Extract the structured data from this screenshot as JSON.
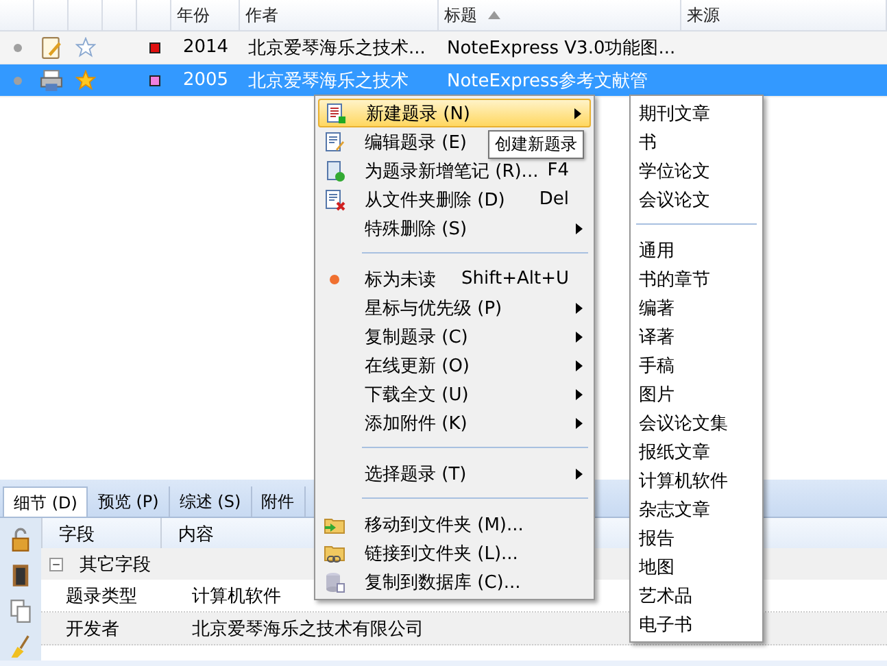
{
  "table": {
    "columns": [
      {},
      {},
      {},
      {},
      {},
      {
        "label": "年份"
      },
      {
        "label": "作者"
      },
      {
        "label": "标题",
        "sorted": true
      },
      {
        "label": "来源"
      }
    ],
    "rows": [
      {
        "selected": false,
        "starred": false,
        "color": "#e01010",
        "year": "2014",
        "author": "北京爱琴海乐之技术...",
        "title": "NoteExpress V3.0功能图..."
      },
      {
        "selected": true,
        "starred": true,
        "color": "#f080e0",
        "year": "2005",
        "author": "北京爱琴海乐之技术",
        "title": "NoteExpress参考文献管"
      }
    ]
  },
  "context_menu": {
    "items": [
      {
        "kind": "item",
        "label": "新建题录 (N)",
        "submenu": true,
        "selected": true
      },
      {
        "kind": "item",
        "label": "编辑题录 (E)",
        "selected": false
      },
      {
        "kind": "item",
        "label": "为题录新增笔记 (R)...",
        "shortcut": "F4",
        "selected": false
      },
      {
        "kind": "item",
        "label": "从文件夹删除 (D)",
        "shortcut": "Del",
        "selected": false
      },
      {
        "kind": "item",
        "label": "特殊删除 (S)",
        "submenu": true,
        "selected": false
      },
      {
        "kind": "separator"
      },
      {
        "kind": "item",
        "label": "标为未读",
        "shortcut": "Shift+Alt+U",
        "selected": false
      },
      {
        "kind": "item",
        "label": "星标与优先级 (P)",
        "submenu": true,
        "selected": false
      },
      {
        "kind": "item",
        "label": "复制题录 (C)",
        "submenu": true,
        "selected": false
      },
      {
        "kind": "item",
        "label": "在线更新 (O)",
        "submenu": true,
        "selected": false
      },
      {
        "kind": "item",
        "label": "下载全文 (U)",
        "submenu": true,
        "selected": false
      },
      {
        "kind": "item",
        "label": "添加附件 (K)",
        "submenu": true,
        "selected": false
      },
      {
        "kind": "separator"
      },
      {
        "kind": "item",
        "label": "选择题录 (T)",
        "submenu": true,
        "selected": false
      },
      {
        "kind": "separator"
      },
      {
        "kind": "item",
        "label": "移动到文件夹 (M)...",
        "selected": false
      },
      {
        "kind": "item",
        "label": "链接到文件夹 (L)...",
        "selected": false
      },
      {
        "kind": "item",
        "label": "复制到数据库 (C)...",
        "selected": false
      }
    ]
  },
  "tooltip": "创建新题录",
  "submenu": {
    "items": [
      {
        "kind": "item",
        "label": "期刊文章"
      },
      {
        "kind": "item",
        "label": "书"
      },
      {
        "kind": "item",
        "label": "学位论文"
      },
      {
        "kind": "item",
        "label": "会议论文"
      },
      {
        "kind": "separator"
      },
      {
        "kind": "item",
        "label": "通用"
      },
      {
        "kind": "item",
        "label": "书的章节"
      },
      {
        "kind": "item",
        "label": "编著"
      },
      {
        "kind": "item",
        "label": "译著"
      },
      {
        "kind": "item",
        "label": "手稿"
      },
      {
        "kind": "item",
        "label": "图片"
      },
      {
        "kind": "item",
        "label": "会议论文集"
      },
      {
        "kind": "item",
        "label": "报纸文章"
      },
      {
        "kind": "item",
        "label": "计算机软件"
      },
      {
        "kind": "item",
        "label": "杂志文章"
      },
      {
        "kind": "item",
        "label": "报告"
      },
      {
        "kind": "item",
        "label": "地图"
      },
      {
        "kind": "item",
        "label": "艺术品"
      },
      {
        "kind": "item",
        "label": "电子书"
      }
    ]
  },
  "detail": {
    "tabs": [
      {
        "label": "细节 (D)",
        "selected": true
      },
      {
        "label": "预览 (P)",
        "selected": false
      },
      {
        "label": "综述 (S)",
        "selected": false
      },
      {
        "label": "附件",
        "selected": false
      }
    ],
    "columns": [
      "字段",
      "内容"
    ],
    "group": {
      "label": "其它字段",
      "expanded": true
    },
    "fields": [
      {
        "name": "题录类型",
        "value": "计算机软件"
      },
      {
        "name": "开发者",
        "value": "北京爱琴海乐之技术有限公司"
      }
    ]
  }
}
